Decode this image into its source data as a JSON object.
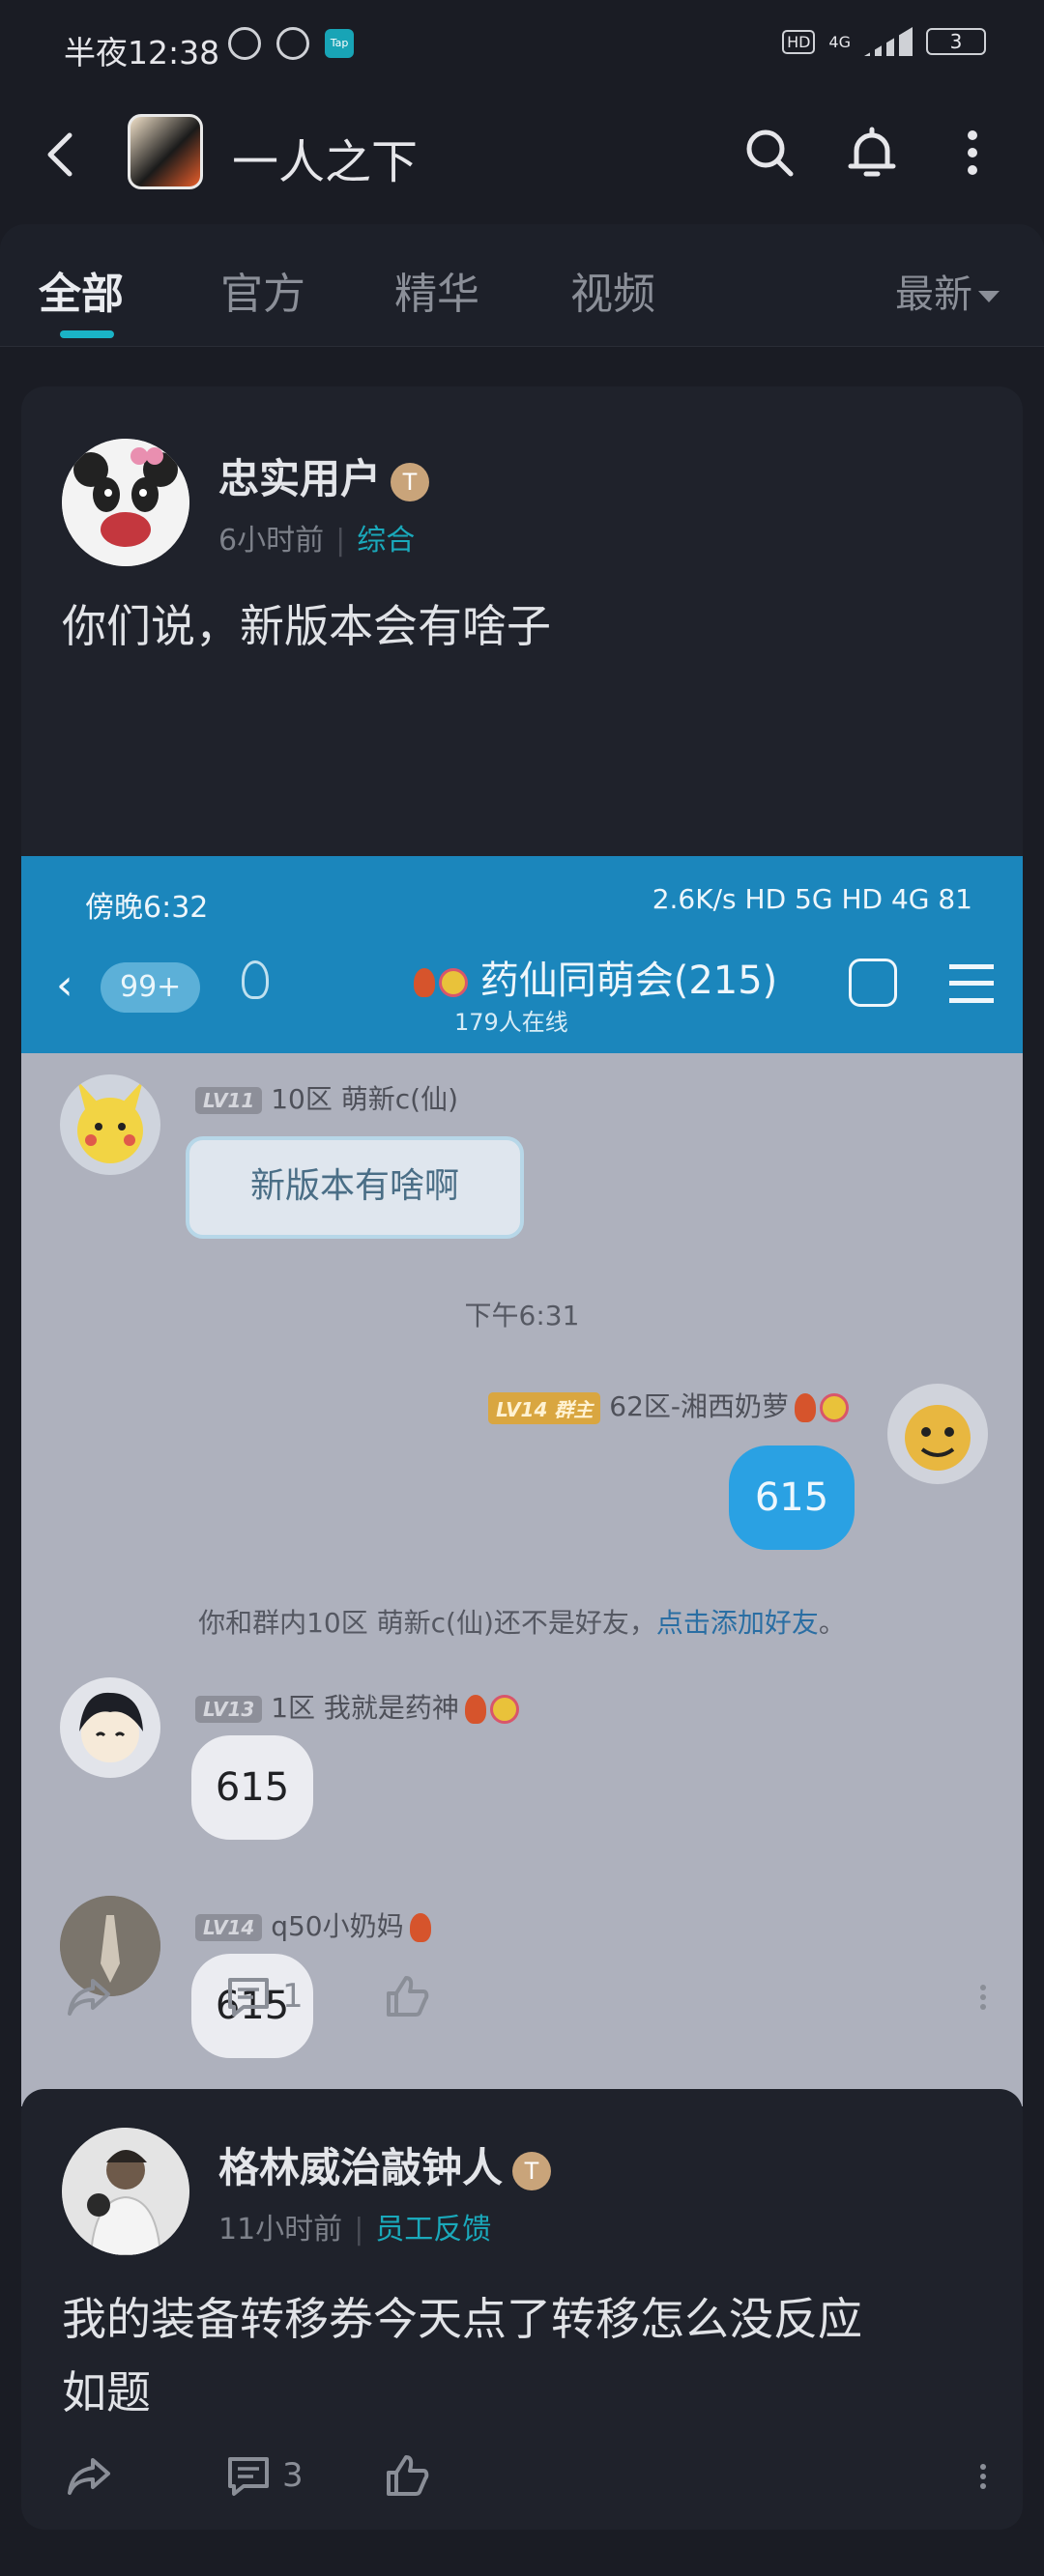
{
  "status_bar": {
    "time": "半夜12:38",
    "tap_label": "Tap",
    "network": "4G",
    "battery": "3"
  },
  "header": {
    "title": "一人之下"
  },
  "tabs": {
    "items": [
      "全部",
      "官方",
      "精华",
      "视频"
    ],
    "active": "全部",
    "sort_label": "最新"
  },
  "posts": [
    {
      "username": "忠实用户",
      "badge": "T",
      "time": "6小时前",
      "category": "综合",
      "text": "你们说，新版本会有啥子",
      "comments": "1",
      "screenshot": {
        "status_time": "傍晚6:32",
        "status_right": "2.6K/s HD 5G HD 4G 81",
        "unread": "99+",
        "group_title": "药仙同萌会(215)",
        "online": "179人在线",
        "messages": [
          {
            "level": "LV11",
            "name": "10区 萌新c(仙)",
            "sticker_text": "新版本有啥啊"
          },
          {
            "time": "下午6:31"
          },
          {
            "level": "LV14",
            "role": "群主",
            "name": "62区-湘西奶萝",
            "text": "615"
          },
          {
            "system": "你和群内10区 萌新c(仙)还不是好友，",
            "system_link": "点击添加好友",
            "system_end": "。"
          },
          {
            "level": "LV13",
            "name": "1区  我就是药神",
            "text": "615"
          },
          {
            "level": "LV14",
            "name": "q50小奶妈",
            "text": "615"
          }
        ]
      }
    },
    {
      "username": "格林威治敲钟人",
      "badge": "T",
      "time": "11小时前",
      "category": "员工反馈",
      "text": "我的装备转移券今天点了转移怎么没反应",
      "text2": "如题",
      "comments": "3"
    }
  ],
  "colors": {
    "accent": "#1aa9bb",
    "background": "#1a1c24",
    "card": "#1f222b",
    "qq_blue": "#1b86bc"
  }
}
